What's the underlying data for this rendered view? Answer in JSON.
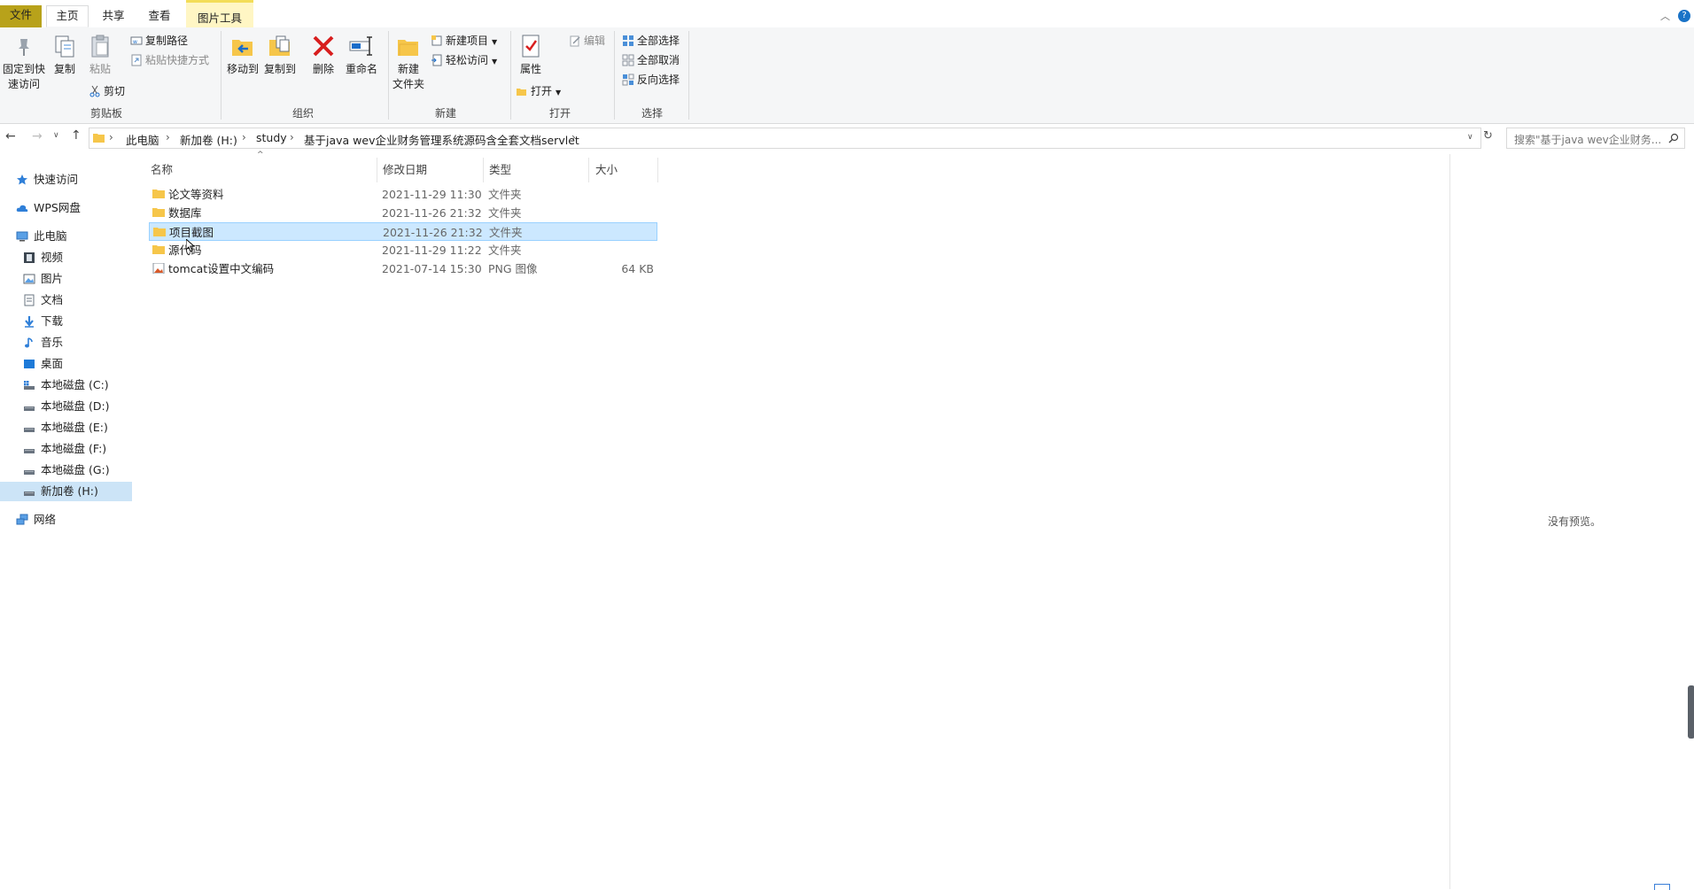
{
  "ribbon_tabs": {
    "file": "文件",
    "home": "主页",
    "share": "共享",
    "view": "查看",
    "picture_tools": "图片工具"
  },
  "ribbon": {
    "clipboard": {
      "pin_label": "固定到快\n速访问",
      "copy_label": "复制",
      "paste_label": "粘贴",
      "copy_path_label": "复制路径",
      "paste_shortcut_label": "粘贴快捷方式",
      "cut_label": "剪切",
      "group_label": "剪贴板"
    },
    "organize": {
      "move_to_label": "移动到",
      "copy_to_label": "复制到",
      "delete_label": "删除",
      "rename_label": "重命名",
      "group_label": "组织"
    },
    "new": {
      "new_item_label": "新建项目",
      "easy_access_label": "轻松访问",
      "new_folder_label": "新建\n文件夹",
      "group_label": "新建"
    },
    "open": {
      "properties_label": "属性",
      "open_label": "打开",
      "edit_label": "编辑",
      "group_label": "打开"
    },
    "select": {
      "select_all_label": "全部选择",
      "select_none_label": "全部取消",
      "invert_label": "反向选择",
      "group_label": "选择"
    }
  },
  "address": {
    "crumbs": [
      "此电脑",
      "新加卷 (H:)",
      "study",
      "基于java wev企业财务管理系统源码含全套文档servlet"
    ],
    "search_placeholder": "搜索\"基于java wev企业财务..."
  },
  "navpane": {
    "quick_access": "快速访问",
    "wps": "WPS网盘",
    "this_pc": "此电脑",
    "videos": "视频",
    "pictures": "图片",
    "documents": "文档",
    "downloads": "下载",
    "music": "音乐",
    "desktop": "桌面",
    "drive_c": "本地磁盘 (C:)",
    "drive_d": "本地磁盘 (D:)",
    "drive_e": "本地磁盘 (E:)",
    "drive_f": "本地磁盘 (F:)",
    "drive_g": "本地磁盘 (G:)",
    "drive_h": "新加卷 (H:)",
    "network": "网络"
  },
  "filelist": {
    "columns": {
      "name": "名称",
      "date": "修改日期",
      "type": "类型",
      "size": "大小"
    },
    "rows": [
      {
        "name": "论文等资料",
        "date": "2021-11-29 11:30",
        "type": "文件夹",
        "size": ""
      },
      {
        "name": "数据库",
        "date": "2021-11-26 21:32",
        "type": "文件夹",
        "size": ""
      },
      {
        "name": "项目截图",
        "date": "2021-11-26 21:32",
        "type": "文件夹",
        "size": ""
      },
      {
        "name": "源代码",
        "date": "2021-11-29 11:22",
        "type": "文件夹",
        "size": ""
      },
      {
        "name": "tomcat设置中文编码",
        "date": "2021-07-14 15:30",
        "type": "PNG 图像",
        "size": "64 KB"
      }
    ]
  },
  "preview": {
    "no_preview": "没有预览。"
  },
  "colors": {
    "file_tab": "#b8a21a",
    "picture_tab_bg": "#fff6c4",
    "selection": "#cce8ff",
    "nav_selected": "#cce4f7",
    "folder": "#f6c64a"
  }
}
